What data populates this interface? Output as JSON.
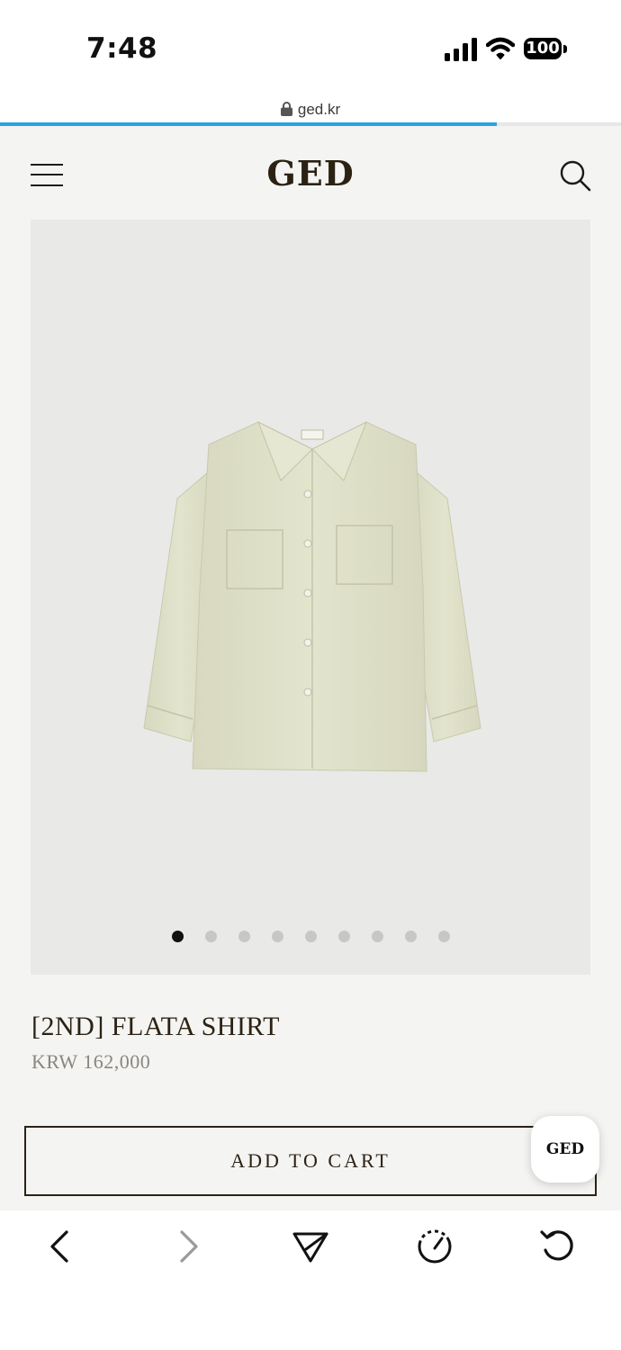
{
  "status": {
    "time": "7:48",
    "battery": "100"
  },
  "browser": {
    "url": "ged.kr",
    "load_progress": 0.8
  },
  "header": {
    "logo": "GED"
  },
  "gallery": {
    "total_images": 9,
    "active_index": 0
  },
  "product": {
    "title": "[2ND] FLATA SHIRT",
    "price": "KRW 162,000",
    "add_to_cart_label": "ADD TO CART"
  },
  "chat_badge": {
    "label": "GED"
  },
  "colors": {
    "accent": "#2c2214",
    "progress": "#2aa3e0",
    "background": "#f4f4f2",
    "image_bg": "#e9e9e7",
    "shirt": "#dfe0c8"
  },
  "icons": [
    "menu-icon",
    "search-icon",
    "lock-icon",
    "back-icon",
    "forward-icon",
    "share-icon",
    "speed-dial-icon",
    "reload-icon"
  ]
}
